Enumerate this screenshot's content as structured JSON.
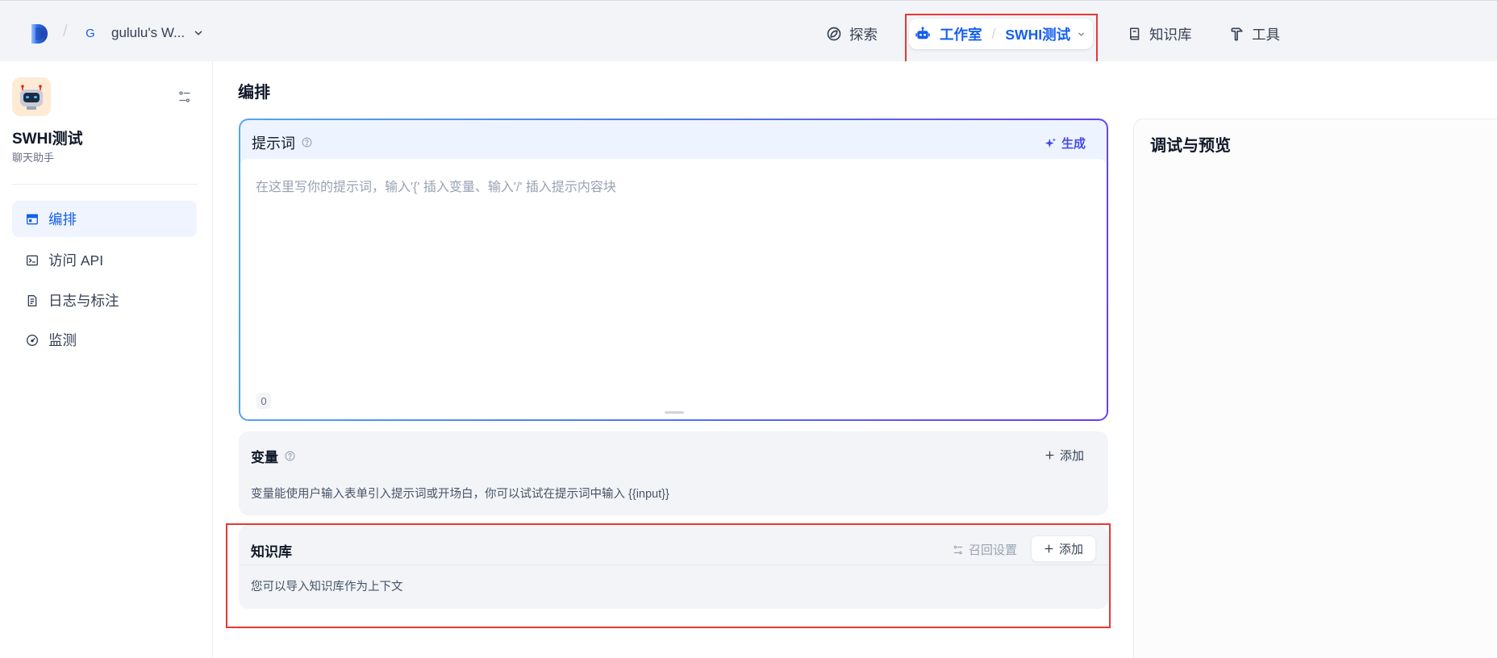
{
  "header": {
    "separator": "/",
    "workspace_avatar": "G",
    "workspace_name": "gululu's W...",
    "nav": {
      "explore": "探索",
      "studio": "工作室",
      "studio_separator": "/",
      "app_name": "SWHI测试",
      "datasets": "知识库",
      "tools": "工具"
    }
  },
  "sidebar": {
    "app_name": "SWHI测试",
    "app_type": "聊天助手",
    "items": [
      {
        "label": "编排",
        "icon": "layout-icon",
        "active": true
      },
      {
        "label": "访问 API",
        "icon": "terminal-icon",
        "active": false
      },
      {
        "label": "日志与标注",
        "icon": "document-icon",
        "active": false
      },
      {
        "label": "监测",
        "icon": "gauge-icon",
        "active": false
      }
    ]
  },
  "main": {
    "title": "编排",
    "prompt": {
      "label": "提示词",
      "generate": "生成",
      "placeholder": "在这里写你的提示词，输入'{' 插入变量、输入'/' 插入提示内容块",
      "char_count": "0"
    },
    "variables": {
      "label": "变量",
      "add": "添加",
      "description": "变量能使用户输入表单引入提示词或开场白，你可以试试在提示词中输入 {{input}}"
    },
    "knowledge": {
      "label": "知识库",
      "retrieval_settings": "召回设置",
      "add": "添加",
      "description": "您可以导入知识库作为上下文"
    }
  },
  "preview": {
    "title": "调试与预览"
  },
  "colors": {
    "accent": "#155eef",
    "generate": "#444ce7",
    "annotation": "#e53935",
    "active_bg": "#eff4ff"
  }
}
